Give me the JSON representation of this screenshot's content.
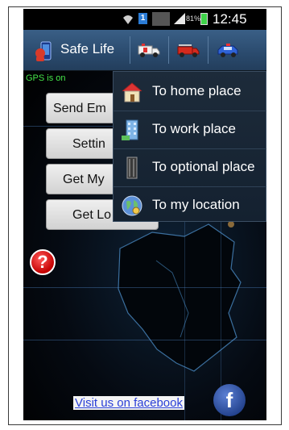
{
  "status_bar": {
    "battery_percent": "81%",
    "sim_label": "1",
    "time": "12:45 AM"
  },
  "action_bar": {
    "title": "Safe Life",
    "icons": [
      "ambulance-icon",
      "fire-truck-icon",
      "police-car-icon"
    ]
  },
  "gps_status": "GPS is on",
  "buttons": [
    {
      "label": "Send Em"
    },
    {
      "label": "Settin"
    },
    {
      "label": "Get My"
    },
    {
      "label": "Get Lo"
    }
  ],
  "dropdown": {
    "items": [
      {
        "label": "To home place",
        "icon": "house-icon"
      },
      {
        "label": "To work place",
        "icon": "office-building-icon"
      },
      {
        "label": "To optional place",
        "icon": "tower-icon"
      },
      {
        "label": "To my location",
        "icon": "globe-icon"
      }
    ]
  },
  "help_icon_glyph": "?",
  "facebook": {
    "link_text": "Visit us on facebook",
    "icon_glyph": "f"
  },
  "colors": {
    "gps_text": "#45e54a",
    "action_bar": "#2a4a6d",
    "link": "#2a3fd8",
    "help": "#c40000",
    "facebook": "#22418c"
  }
}
